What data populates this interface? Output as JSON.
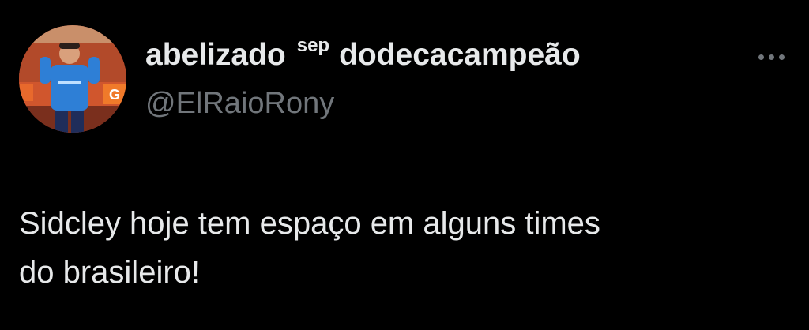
{
  "tweet": {
    "author": {
      "display_name_part1": "abelizado",
      "display_name_sup": "sep",
      "display_name_part2": "dodecacampeão",
      "handle": "@ElRaioRony"
    },
    "text_line1": "Sidcley hoje tem espaço em alguns times",
    "text_line2": "do brasileiro!",
    "more_icon": "more-horizontal-icon"
  },
  "colors": {
    "background": "#000000",
    "primary_text": "#e7e9ea",
    "secondary_text": "#71767b"
  }
}
